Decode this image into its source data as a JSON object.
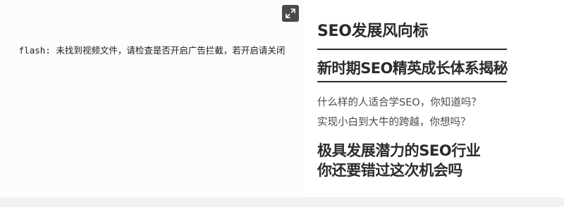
{
  "player": {
    "flash_message": "flash: 未找到视频文件，请检查是否开启广告拦截，若开启请关闭",
    "fullscreen_icon": "expand-icon"
  },
  "sidebar": {
    "title": "SEO发展风向标",
    "subtitle": "新时期SEO精英成长体系揭秘",
    "questions": [
      "什么样的人适合学SEO，你知道吗？",
      "实现小白到大牛的跨越，你想吗？"
    ],
    "promo_line1": "极具发展潜力的SEO行业",
    "promo_line2": "你还要错过这次机会吗"
  }
}
